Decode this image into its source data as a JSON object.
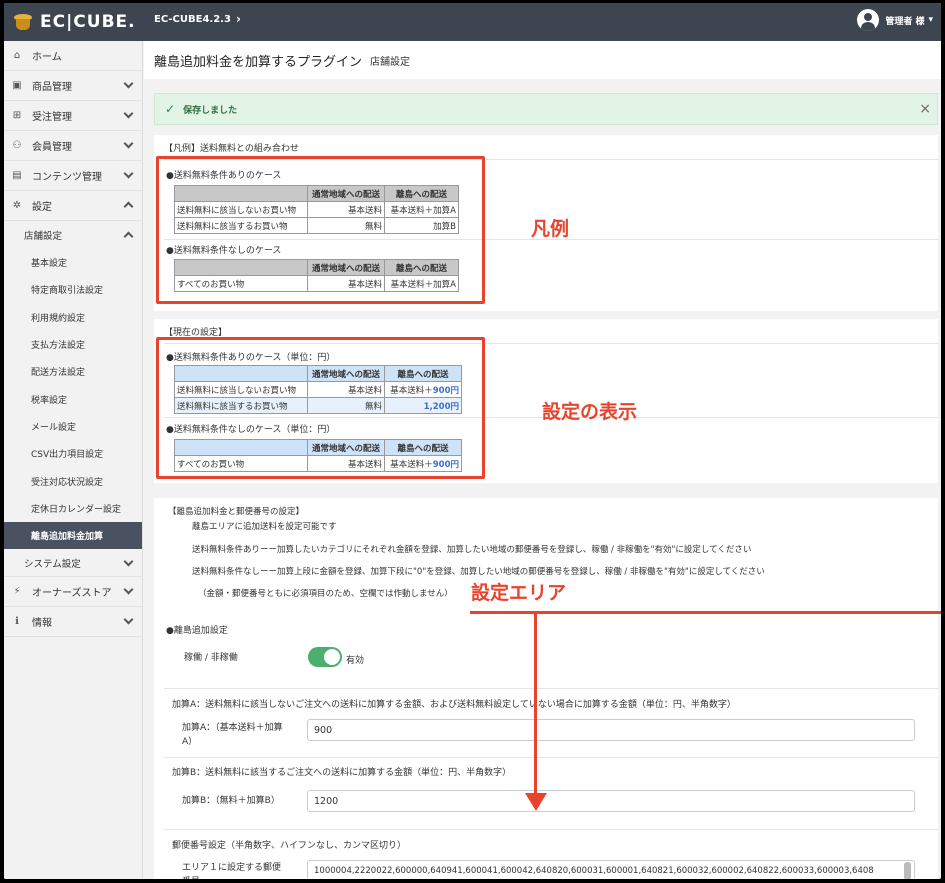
{
  "header": {
    "logo_text": "EC|CUBE.",
    "version": "EC-CUBE4.2.3",
    "user_name": "管理者 様",
    "user_chevron": "▾"
  },
  "sidebar": {
    "items": [
      {
        "label": "ホーム",
        "icon": "home-icon",
        "glyph": "⌂"
      },
      {
        "label": "商品管理",
        "icon": "box-icon",
        "glyph": "▣"
      },
      {
        "label": "受注管理",
        "icon": "cart-icon",
        "glyph": "⊞"
      },
      {
        "label": "会員管理",
        "icon": "users-icon",
        "glyph": "⚇"
      },
      {
        "label": "コンテンツ管理",
        "icon": "file-icon",
        "glyph": "▤"
      },
      {
        "label": "設定",
        "icon": "gear-icon",
        "glyph": "✲"
      }
    ],
    "store_settings": "店舗設定",
    "leaves": [
      "基本設定",
      "特定商取引法設定",
      "利用規約設定",
      "支払方法設定",
      "配送方法設定",
      "税率設定",
      "メール設定",
      "CSV出力項目設定",
      "受注対応状況設定",
      "定休日カレンダー設定",
      "離島追加料金加算"
    ],
    "system_settings": "システム設定",
    "owners_store": {
      "label": "オーナーズストア",
      "glyph": "⚡"
    },
    "info": {
      "label": "情報",
      "glyph": "ℹ"
    }
  },
  "page": {
    "title": "離島追加料金を加算するプラグイン",
    "subtitle": "店舗設定"
  },
  "alert": {
    "message": "保存しました",
    "close": "×"
  },
  "example": {
    "heading": "【凡例】送料無料との組み合わせ",
    "case1_title": "●送料無料条件ありのケース",
    "case2_title": "●送料無料条件なしのケース",
    "col_normal": "通常地域への配送",
    "col_island": "離島への配送",
    "case1_rows": [
      [
        "送料無料に該当しないお買い物",
        "基本送料",
        "基本送料＋加算A"
      ],
      [
        "送料無料に該当するお買い物",
        "無料",
        "加算B"
      ]
    ],
    "case2_rows": [
      [
        "すべてのお買い物",
        "基本送料",
        "基本送料＋加算A"
      ]
    ],
    "annotation": "凡例"
  },
  "current": {
    "heading": "【現在の設定】",
    "case1_title": "●送料無料条件ありのケース（単位：円）",
    "case2_title": "●送料無料条件なしのケース（単位：円）",
    "col_normal": "通常地域への配送",
    "col_island": "離島への配送",
    "case1_rows": [
      [
        "送料無料に該当しないお買い物",
        "基本送料",
        "基本送料＋",
        "900円"
      ],
      [
        "送料無料に該当するお買い物",
        "無料",
        "",
        "1,200円"
      ]
    ],
    "case2_rows": [
      [
        "すべてのお買い物",
        "基本送料",
        "基本送料＋",
        "900円"
      ]
    ],
    "annotation": "設定の表示"
  },
  "settings_desc": {
    "heading": "【離島追加料金と郵便番号の設定】",
    "lines": [
      "離島エリアに追加送料を設定可能です",
      "送料無料条件ありーー加算したいカテゴリにそれぞれ金額を登録、加算したい地域の郵便番号を登録し、稼働 / 非稼働を\"有効\"に設定してください",
      "送料無料条件なしーー加算上段に金額を登録、加算下段に\"0\"を登録、加算したい地域の郵便番号を登録し、稼働 / 非稼働を\"有効\"に設定してください",
      "（金額・郵便番号ともに必須項目のため、空欄では作動しません）"
    ],
    "annotation": "設定エリア"
  },
  "form": {
    "section_title": "●離島追加設定",
    "active_label": "稼働 / 非稼働",
    "active_value": "有効",
    "addA_heading": "加算A：送料無料に該当しないご注文への送料に加算する金額、および送料無料設定していない場合に加算する金額（単位：円、半角数字）",
    "addA_label_1": "加算A：（基本送料＋加算",
    "addA_label_2": "A）",
    "addA_value": "900",
    "addB_heading": "加算B：送料無料に該当するご注文への送料に加算する金額（単位：円、半角数字）",
    "addB_label": "加算B：（無料＋加算B）",
    "addB_value": "1200",
    "zip_heading": "郵便番号設定（半角数字、ハイフンなし、カンマ区切り）",
    "zip_label_1": "エリア１に設定する郵便",
    "zip_label_2": "番号",
    "zip_value": "1000004,2220022,600000,640941,600041,600042,640820,600031,600001,640821,600032,600002,640822,600033,600003,6408"
  },
  "colors": {
    "header_bg": "#3d4551",
    "accent_red": "#e8432c",
    "success_bg": "#e2f4e6",
    "toggle_green": "#4caf6e",
    "highlight_blue": "#3a6fd0"
  }
}
